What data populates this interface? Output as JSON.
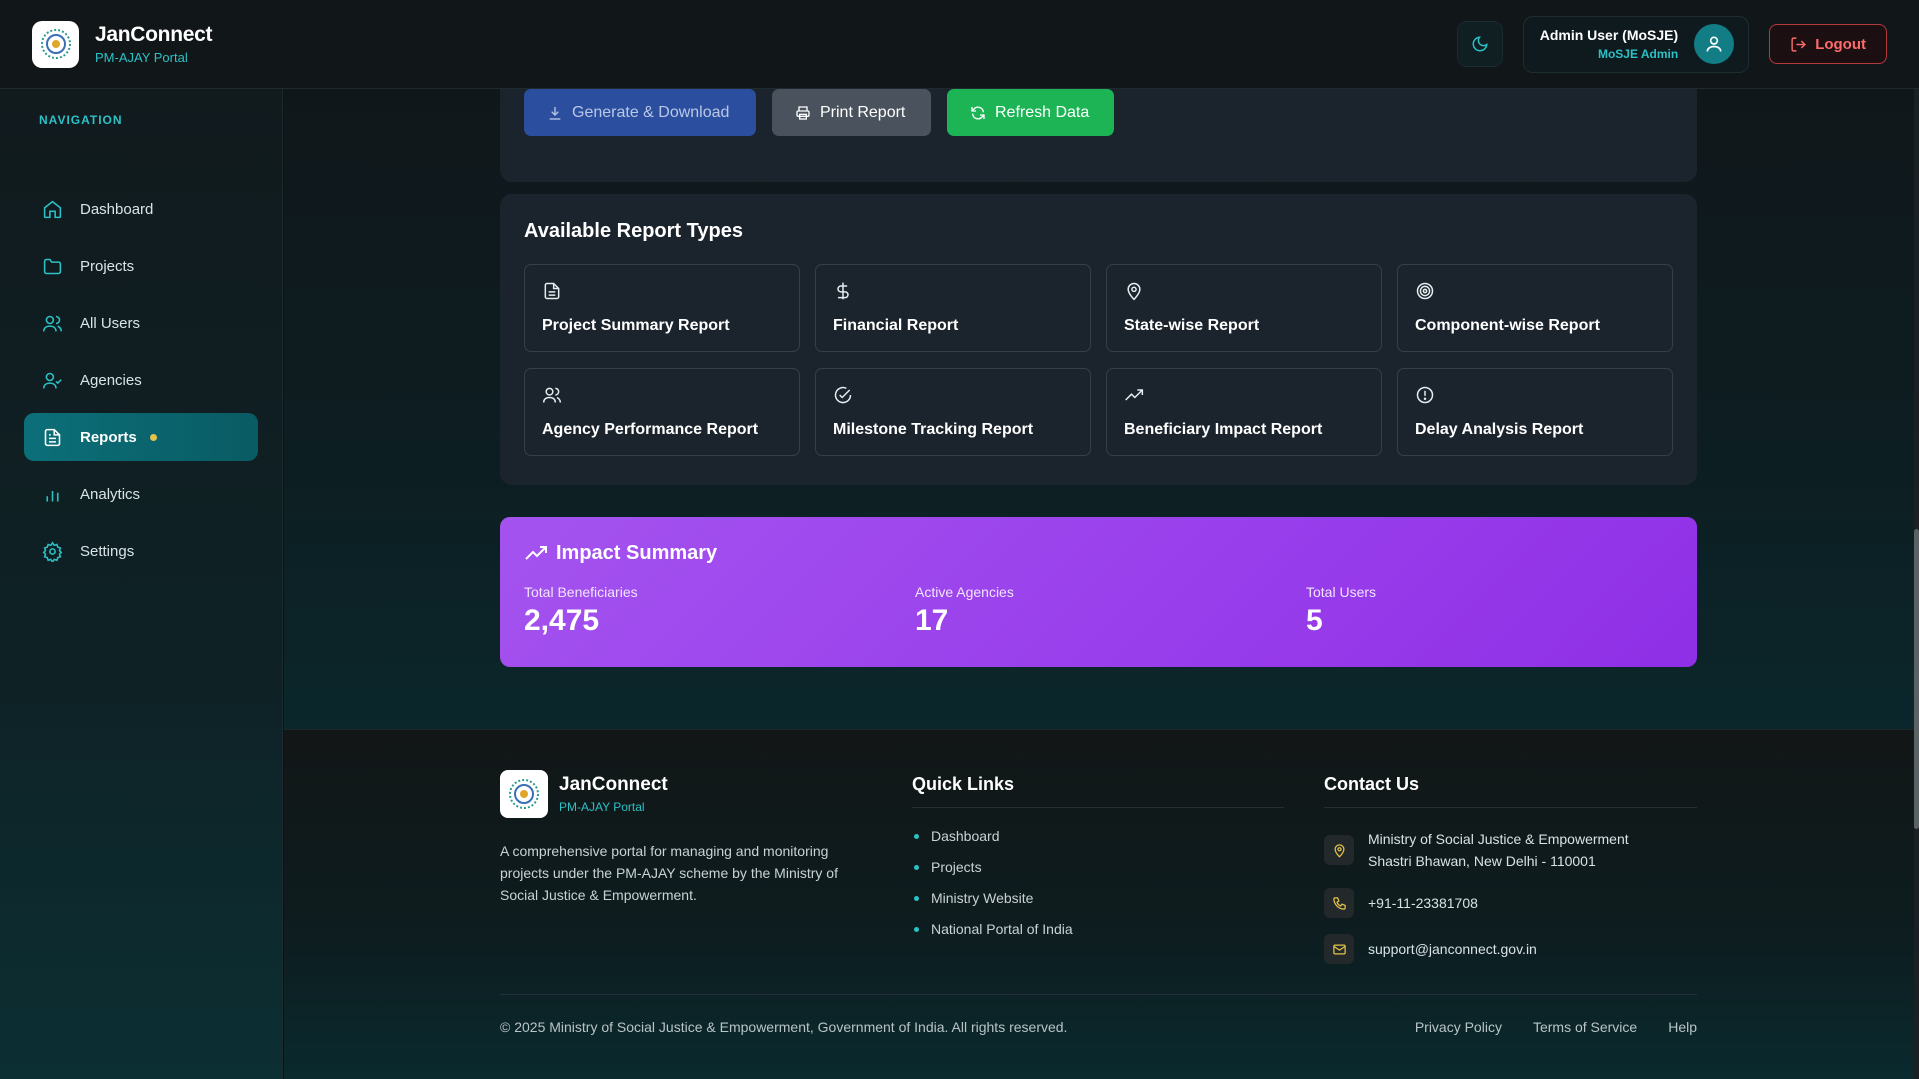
{
  "header": {
    "brand_name": "JanConnect",
    "brand_sub": "PM-AJAY Portal",
    "user_name": "Admin User (MoSJE)",
    "user_role": "MoSJE Admin",
    "logout_label": "Logout"
  },
  "sidebar": {
    "heading": "NAVIGATION",
    "items": [
      {
        "label": "Dashboard",
        "icon": "home-icon"
      },
      {
        "label": "Projects",
        "icon": "folder-icon"
      },
      {
        "label": "All Users",
        "icon": "users-icon"
      },
      {
        "label": "Agencies",
        "icon": "user-check-icon"
      },
      {
        "label": "Reports",
        "icon": "file-text-icon",
        "active": true
      },
      {
        "label": "Analytics",
        "icon": "bar-chart-icon"
      },
      {
        "label": "Settings",
        "icon": "gear-icon"
      }
    ]
  },
  "actions": {
    "generate_label": "Generate & Download",
    "print_label": "Print Report",
    "refresh_label": "Refresh Data"
  },
  "report_types": {
    "title": "Available Report Types",
    "items": [
      {
        "label": "Project Summary Report",
        "icon": "document-icon"
      },
      {
        "label": "Financial Report",
        "icon": "dollar-icon"
      },
      {
        "label": "State-wise Report",
        "icon": "map-pin-icon"
      },
      {
        "label": "Component-wise Report",
        "icon": "target-icon"
      },
      {
        "label": "Agency Performance Report",
        "icon": "users-icon"
      },
      {
        "label": "Milestone Tracking Report",
        "icon": "check-circle-icon"
      },
      {
        "label": "Beneficiary Impact Report",
        "icon": "trending-up-icon"
      },
      {
        "label": "Delay Analysis Report",
        "icon": "alert-circle-icon"
      }
    ]
  },
  "impact": {
    "title": "Impact Summary",
    "stats": [
      {
        "label": "Total Beneficiaries",
        "value": "2,475"
      },
      {
        "label": "Active Agencies",
        "value": "17"
      },
      {
        "label": "Total Users",
        "value": "5"
      }
    ]
  },
  "footer": {
    "brand_name": "JanConnect",
    "brand_sub": "PM-AJAY Portal",
    "description": "A comprehensive portal for managing and monitoring projects under the PM-AJAY scheme by the Ministry of Social Justice & Empowerment.",
    "quick_links_heading": "Quick Links",
    "quick_links": [
      "Dashboard",
      "Projects",
      "Ministry Website",
      "National Portal of India"
    ],
    "contact_heading": "Contact Us",
    "address_line1": "Ministry of Social Justice & Empowerment",
    "address_line2": "Shastri Bhawan, New Delhi - 110001",
    "phone": "+91-11-23381708",
    "email": "support@janconnect.gov.in",
    "copyright": "© 2025 Ministry of Social Justice & Empowerment, Government of India. All rights reserved.",
    "legal_links": [
      "Privacy Policy",
      "Terms of Service",
      "Help"
    ]
  },
  "colors": {
    "accent": "#2cc1c6",
    "impact_gradient_start": "#a453ef",
    "impact_gradient_end": "#8f2fe6",
    "refresh_green": "#1db455",
    "logout_red": "#ff6b6b"
  }
}
